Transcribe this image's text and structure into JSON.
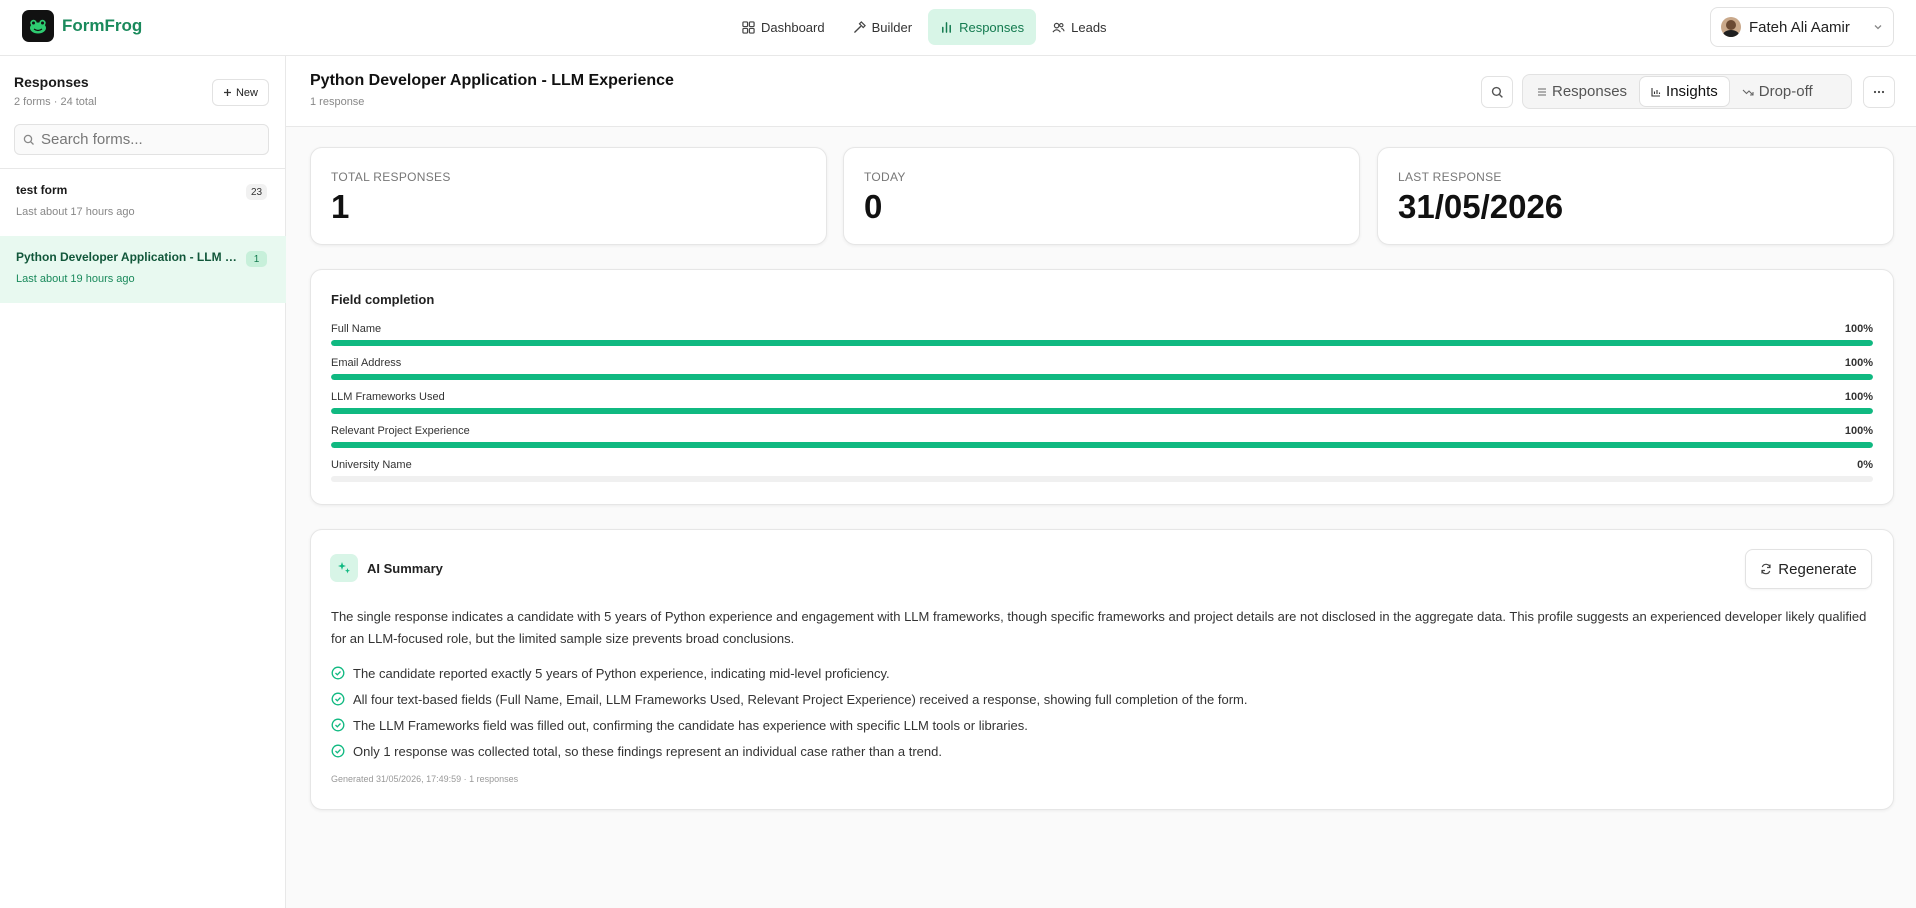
{
  "app": {
    "brand": "FormFrog"
  },
  "nav": [
    {
      "label": "Dashboard",
      "icon": "dashboard-icon"
    },
    {
      "label": "Builder",
      "icon": "hammer-icon"
    },
    {
      "label": "Responses",
      "icon": "bar-chart-icon",
      "active": true
    },
    {
      "label": "Leads",
      "icon": "users-icon"
    }
  ],
  "user": {
    "name": "Fateh Ali Aamir"
  },
  "sidebar": {
    "title": "Responses",
    "subtitle": "2 forms · 24 total",
    "new_label": "New",
    "search_placeholder": "Search forms...",
    "forms": [
      {
        "name": "test form",
        "time": "Last about 17 hours ago",
        "count": "23"
      },
      {
        "name": "Python Developer Application - LLM Experience",
        "time": "Last about 19 hours ago",
        "count": "1",
        "active": true
      }
    ]
  },
  "header": {
    "title": "Python Developer Application - LLM Experience",
    "subtitle": "1 response",
    "tabs": [
      {
        "label": "Responses",
        "icon": "list-icon"
      },
      {
        "label": "Insights",
        "icon": "bar-chart-icon",
        "active": true
      },
      {
        "label": "Drop-off",
        "icon": "trend-down-icon"
      }
    ]
  },
  "stats": [
    {
      "label": "TOTAL RESPONSES",
      "value": "1"
    },
    {
      "label": "TODAY",
      "value": "0"
    },
    {
      "label": "LAST RESPONSE",
      "value": "31/05/2026"
    }
  ],
  "field_completion": {
    "title": "Field completion",
    "fields": [
      {
        "name": "Full Name",
        "pct_label": "100%",
        "pct": 100
      },
      {
        "name": "Email Address",
        "pct_label": "100%",
        "pct": 100
      },
      {
        "name": "LLM Frameworks Used",
        "pct_label": "100%",
        "pct": 100
      },
      {
        "name": "Relevant Project Experience",
        "pct_label": "100%",
        "pct": 100
      },
      {
        "name": "University Name",
        "pct_label": "0%",
        "pct": 0
      }
    ]
  },
  "ai_summary": {
    "title": "AI Summary",
    "regenerate_label": "Regenerate",
    "paragraph": "The single response indicates a candidate with 5 years of Python experience and engagement with LLM frameworks, though specific frameworks and project details are not disclosed in the aggregate data. This profile suggests an experienced developer likely qualified for an LLM-focused role, but the limited sample size prevents broad conclusions.",
    "insights": [
      "The candidate reported exactly 5 years of Python experience, indicating mid-level proficiency.",
      "All four text-based fields (Full Name, Email, LLM Frameworks Used, Relevant Project Experience) received a response, showing full completion of the form.",
      "The LLM Frameworks field was filled out, confirming the candidate has experience with specific LLM tools or libraries.",
      "Only 1 response was collected total, so these findings represent an individual case rather than a trend."
    ],
    "footer": "Generated 31/05/2026, 17:49:59 · 1 responses"
  },
  "colors": {
    "accent": "#10b981",
    "accent_dark": "#137a4f",
    "active_bg": "#d8f5e7"
  }
}
